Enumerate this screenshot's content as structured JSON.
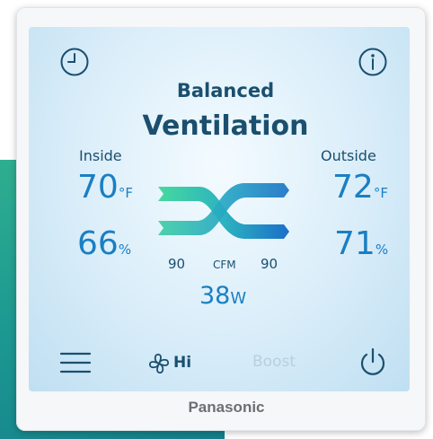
{
  "brand": "Panasonic",
  "mode": {
    "line1": "Balanced",
    "line2": "Ventilation"
  },
  "inside": {
    "label": "Inside",
    "temp": "70",
    "temp_unit": "°F",
    "humidity": "66",
    "humidity_unit": "%"
  },
  "outside": {
    "label": "Outside",
    "temp": "72",
    "temp_unit": "°F",
    "humidity": "71",
    "humidity_unit": "%"
  },
  "airflow": {
    "supply": "90",
    "unit": "CFM",
    "exhaust": "90"
  },
  "power": {
    "value": "38",
    "unit": "W"
  },
  "fan": {
    "speed": "Hi"
  },
  "boost": {
    "label": "Boost"
  },
  "colors": {
    "text": "#1a4f6e",
    "accent": "#1a7fc3",
    "arrow_green": "#3fd29a",
    "arrow_blue": "#1b73c7",
    "disabled": "#b9cfdc"
  },
  "icons": [
    "clock-icon",
    "info-icon",
    "menu-icon",
    "fan-icon",
    "power-icon"
  ]
}
